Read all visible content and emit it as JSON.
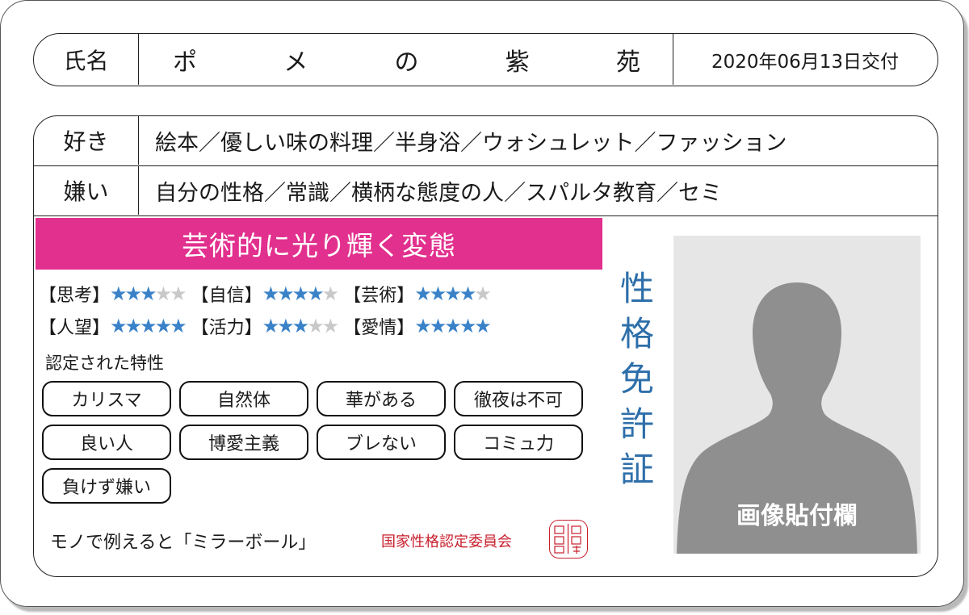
{
  "card": {
    "name_label": "氏名",
    "name_chars": [
      "ポ",
      "メ",
      "の",
      "紫",
      "苑"
    ],
    "issued": "2020年06月13日交付",
    "likes_label": "好き",
    "likes_value": "絵本／優しい味の料理／半身浴／ウォシュレット／ファッション",
    "dislikes_label": "嫌い",
    "dislikes_value": "自分の性格／常識／横柄な態度の人／スパルタ教育／セミ",
    "headline": "芸術的に光り輝く変態",
    "ratings": [
      {
        "label": "【思考】",
        "stars": 3,
        "max": 5
      },
      {
        "label": "【自信】",
        "stars": 4,
        "max": 5
      },
      {
        "label": "【芸術】",
        "stars": 4,
        "max": 5
      },
      {
        "label": "【人望】",
        "stars": 5,
        "max": 5
      },
      {
        "label": "【活力】",
        "stars": 3,
        "max": 5
      },
      {
        "label": "【愛情】",
        "stars": 5,
        "max": 5
      }
    ],
    "traits_title": "認定された特性",
    "traits": [
      "カリスマ",
      "自然体",
      "華がある",
      "徹夜は不可",
      "良い人",
      "博愛主義",
      "ブレない",
      "コミュ力",
      "負けず嫌い"
    ],
    "object_line": "モノで例えると「ミラーボール」",
    "committee": "国家性格認定委員会",
    "vertical_title": [
      "性",
      "格",
      "免",
      "許",
      "証"
    ],
    "photo_caption": "画像貼付欄"
  },
  "colors": {
    "headline_bg": "#e2308e",
    "star_on": "#3a82c8",
    "star_off": "#c9c9c9",
    "title_blue": "#2e6faa",
    "seal_red": "#c8202e"
  },
  "icons": {
    "seal": "stamp-seal",
    "photo": "person-silhouette"
  }
}
